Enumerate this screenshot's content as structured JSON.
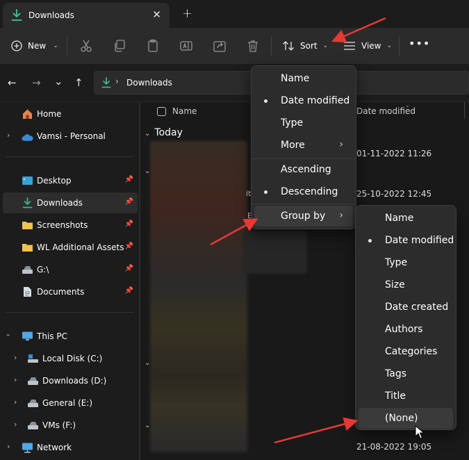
{
  "colors": {
    "accent_green": "#3fb68b",
    "folder_yellow": "#f2c34b",
    "arrow_red": "#e53935",
    "home_orange": "#e8834d",
    "cloud_blue": "#3a8bd6",
    "pc_blue": "#4ea8e8"
  },
  "tab": {
    "title": "Downloads",
    "close": "✕",
    "new": "+"
  },
  "toolbar": {
    "new_label": "New",
    "sort_label": "Sort",
    "view_label": "View",
    "more": "•••",
    "chevron": "⌄"
  },
  "nav": {
    "back": "←",
    "forward": "→",
    "recent": "⌄",
    "up": "↑"
  },
  "address": {
    "separator": "›",
    "location": "Downloads"
  },
  "sidebar": {
    "home": "Home",
    "onedrive": "Vamsi - Personal",
    "desktop": "Desktop",
    "downloads": "Downloads",
    "screenshots": "Screenshots",
    "wl_assets": "WL Additional Assets",
    "g_drive": "G:\\",
    "documents": "Documents",
    "this_pc": "This PC",
    "local_disk": "Local Disk (C:)",
    "downloads_d": "Downloads (D:)",
    "general_e": "General (E:)",
    "vms_f": "VMs (F:)",
    "network": "Network"
  },
  "content": {
    "col_name": "Name",
    "col_date": "Date modified",
    "group_today": "Today",
    "dates": [
      "01-11-2022 11:26",
      "25-10-2022 12:45",
      "21-08-2022 19:05"
    ],
    "fragments": [
      "it",
      "E"
    ]
  },
  "sort_menu": {
    "items": [
      "Name",
      "Date modified",
      "Type",
      "More"
    ],
    "order": [
      "Ascending",
      "Descending"
    ],
    "group_by": "Group by",
    "selected_sort": "Date modified",
    "selected_order": "Descending"
  },
  "group_menu": {
    "items": [
      "Name",
      "Date modified",
      "Type",
      "Size",
      "Date created",
      "Authors",
      "Categories",
      "Tags",
      "Title",
      "(None)"
    ],
    "selected": "Date modified",
    "hovered": "(None)"
  }
}
